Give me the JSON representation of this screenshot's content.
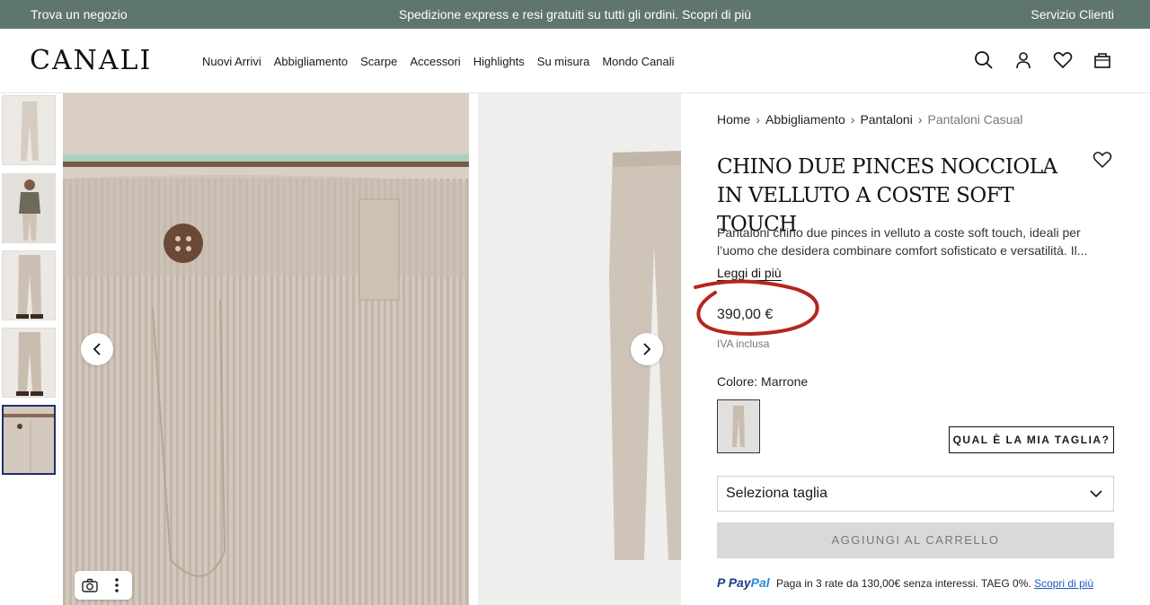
{
  "topbar": {
    "left": "Trova un negozio",
    "center": "Spedizione express e resi gratuiti su tutti gli ordini. Scopri di più",
    "right": "Servizio Clienti"
  },
  "header": {
    "logo": "CANALI",
    "nav": [
      "Nuovi Arrivi",
      "Abbigliamento",
      "Scarpe",
      "Accessori",
      "Highlights",
      "Su misura",
      "Mondo Canali"
    ]
  },
  "breadcrumb": [
    "Home",
    "Abbigliamento",
    "Pantaloni",
    "Pantaloni Casual"
  ],
  "product": {
    "title": "Chino due pinces nocciola in velluto a coste soft touch",
    "description": "Pantaloni chino due pinces in velluto a coste soft touch, ideali per l’uomo che desidera combinare comfort sofisticato e versatilità. Il...",
    "read_more": "Leggi di più",
    "price": "390,00 €",
    "vat": "IVA inclusa",
    "color_label": "Colore:",
    "color_value": "Marrone",
    "size_guide": "QUAL È LA MIA TAGLIA?",
    "size_select": "Seleziona taglia",
    "add_to_cart": "AGGIUNGI AL CARRELLO"
  },
  "paypal": {
    "brand_a": "Pay",
    "brand_b": "Pal",
    "text": "Paga in 3 rate da 130,00€ senza interessi. TAEG 0%.",
    "link": "Scopri di più"
  },
  "colors": {
    "topbar": "#5f7570",
    "annotation": "#b3261e",
    "fabric": "#cfc4ba"
  }
}
